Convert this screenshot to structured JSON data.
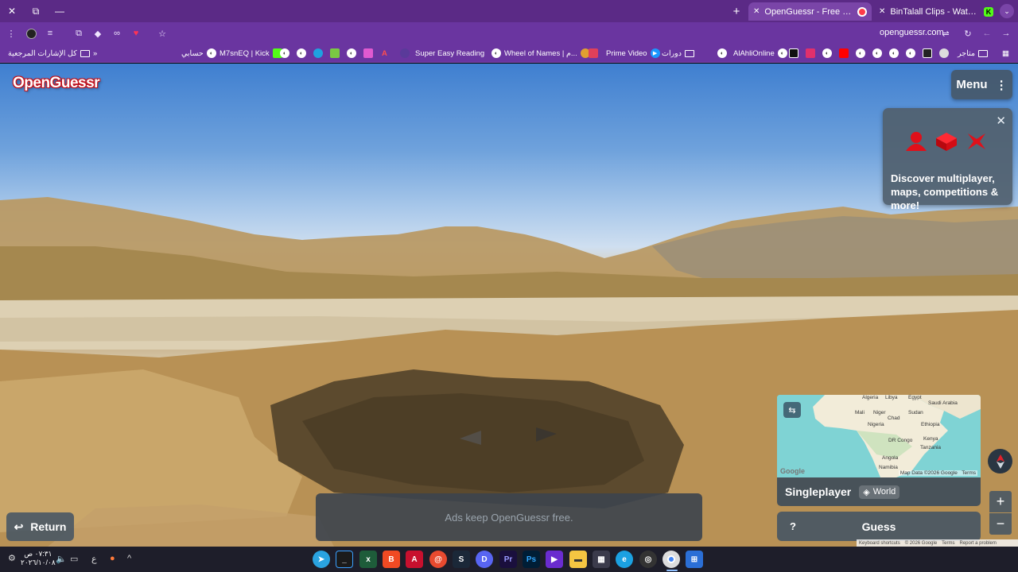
{
  "browser": {
    "tabs": [
      {
        "title": "OpenGuessr - Free GeoGuessr Alternative",
        "active": true
      },
      {
        "title": "BinTalall Clips - Watch Live on Kick",
        "active": false
      }
    ],
    "url": "openguessr.com",
    "bookmarks_right_to_left": [
      {
        "label": "متاجر"
      },
      {
        "label": "AlAhliOnline"
      },
      {
        "label": "دورات"
      },
      {
        "label": "Prime Video"
      },
      {
        "label": "Wheel of Names | م..."
      },
      {
        "label": "Super Easy Reading"
      },
      {
        "label": "M7snEQ | Kick"
      },
      {
        "label": "حسابي"
      }
    ],
    "all_bookmarks_label": "كل الإشارات المرجعية"
  },
  "game": {
    "logo": "OpenGuessr",
    "menu_label": "Menu",
    "promo_text": "Discover multiplayer, maps, competitions & more!",
    "mode_label": "Singleplayer",
    "map_label": "World",
    "guess_label": "Guess",
    "help_label": "?",
    "return_label": "Return",
    "ad_text": "Ads keep OpenGuessr free.",
    "map_attribution": "Map Data ©2026 Google",
    "map_terms": "Terms",
    "map_logo": "Google",
    "map_places": [
      "Algeria",
      "Libya",
      "Egypt",
      "Mali",
      "Niger",
      "Chad",
      "Sudan",
      "Saudi Arabia",
      "Nigeria",
      "Ethiopia",
      "Kenya",
      "Tanzania",
      "Angola",
      "DR Congo",
      "Namibia"
    ],
    "footer": [
      "Keyboard shortcuts",
      "© 2026 Google",
      "Terms",
      "Report a problem"
    ]
  },
  "taskbar": {
    "time": "٠٧:٣١ ص",
    "date": "٢٠٢٦/١٠/٠٨",
    "lang": "ع",
    "apps": [
      "telegram",
      "terminal",
      "excel",
      "brave",
      "affinity",
      "app-red",
      "steam",
      "discord",
      "premiere",
      "photoshop",
      "video-app",
      "file-explorer",
      "store",
      "edge",
      "obs",
      "chrome",
      "windows"
    ]
  },
  "colors": {
    "tab_bg": "#5b2a86",
    "toolbar_bg": "#6a35a0",
    "panel_bg": "#46556a",
    "logo_red": "#c4101a"
  }
}
